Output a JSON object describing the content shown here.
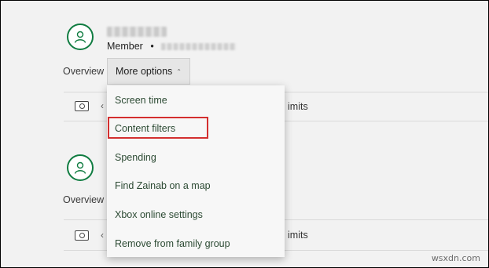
{
  "member": {
    "role": "Member",
    "separator": "•"
  },
  "nav": {
    "overview": "Overview",
    "more_options": "More options",
    "chevron": "⌃"
  },
  "rows": {
    "limits_1": "imits",
    "limits_2": "imits",
    "tail": "‹"
  },
  "menu": {
    "items": [
      {
        "label": "Screen time"
      },
      {
        "label": "Content filters"
      },
      {
        "label": "Spending"
      },
      {
        "label": "Find Zainab on a map"
      },
      {
        "label": "Xbox online settings"
      },
      {
        "label": "Remove from family group"
      }
    ],
    "highlighted_index": 1,
    "highlight_color": "#d32f2f"
  },
  "watermark": "wsxdn.com",
  "colors": {
    "accent": "#107c41",
    "menu_text": "#2d4b34",
    "background": "#f2f2f2"
  }
}
